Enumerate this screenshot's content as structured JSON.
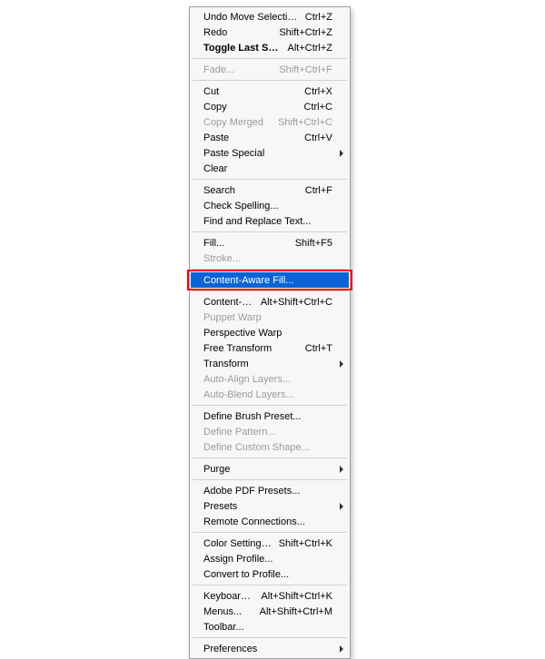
{
  "menu": {
    "name": "edit-menu",
    "items": [
      {
        "kind": "item",
        "id": "undo-move-selection",
        "label": "Undo Move Selection",
        "shortcut": "Ctrl+Z"
      },
      {
        "kind": "item",
        "id": "redo",
        "label": "Redo",
        "shortcut": "Shift+Ctrl+Z"
      },
      {
        "kind": "item",
        "id": "toggle-last-state",
        "label": "Toggle Last State",
        "shortcut": "Alt+Ctrl+Z",
        "bold": true
      },
      {
        "kind": "sep"
      },
      {
        "kind": "item",
        "id": "fade",
        "label": "Fade...",
        "shortcut": "Shift+Ctrl+F",
        "disabled": true
      },
      {
        "kind": "sep"
      },
      {
        "kind": "item",
        "id": "cut",
        "label": "Cut",
        "shortcut": "Ctrl+X"
      },
      {
        "kind": "item",
        "id": "copy",
        "label": "Copy",
        "shortcut": "Ctrl+C"
      },
      {
        "kind": "item",
        "id": "copy-merged",
        "label": "Copy Merged",
        "shortcut": "Shift+Ctrl+C",
        "disabled": true
      },
      {
        "kind": "item",
        "id": "paste",
        "label": "Paste",
        "shortcut": "Ctrl+V"
      },
      {
        "kind": "item",
        "id": "paste-special",
        "label": "Paste Special",
        "submenu": true
      },
      {
        "kind": "item",
        "id": "clear",
        "label": "Clear"
      },
      {
        "kind": "sep"
      },
      {
        "kind": "item",
        "id": "search",
        "label": "Search",
        "shortcut": "Ctrl+F"
      },
      {
        "kind": "item",
        "id": "check-spelling",
        "label": "Check Spelling..."
      },
      {
        "kind": "item",
        "id": "find-replace",
        "label": "Find and Replace Text..."
      },
      {
        "kind": "sep"
      },
      {
        "kind": "item",
        "id": "fill",
        "label": "Fill...",
        "shortcut": "Shift+F5"
      },
      {
        "kind": "item",
        "id": "stroke",
        "label": "Stroke...",
        "disabled": true
      },
      {
        "kind": "sep"
      },
      {
        "kind": "item",
        "id": "content-aware-fill",
        "label": "Content-Aware Fill...",
        "highlight": true,
        "outline": true
      },
      {
        "kind": "sep"
      },
      {
        "kind": "item",
        "id": "content-aware-scale",
        "label": "Content-Aware Scale",
        "shortcut": "Alt+Shift+Ctrl+C"
      },
      {
        "kind": "item",
        "id": "puppet-warp",
        "label": "Puppet Warp",
        "disabled": true
      },
      {
        "kind": "item",
        "id": "perspective-warp",
        "label": "Perspective Warp"
      },
      {
        "kind": "item",
        "id": "free-transform",
        "label": "Free Transform",
        "shortcut": "Ctrl+T"
      },
      {
        "kind": "item",
        "id": "transform",
        "label": "Transform",
        "submenu": true
      },
      {
        "kind": "item",
        "id": "auto-align-layers",
        "label": "Auto-Align Layers...",
        "disabled": true
      },
      {
        "kind": "item",
        "id": "auto-blend-layers",
        "label": "Auto-Blend Layers...",
        "disabled": true
      },
      {
        "kind": "sep"
      },
      {
        "kind": "item",
        "id": "define-brush-preset",
        "label": "Define Brush Preset..."
      },
      {
        "kind": "item",
        "id": "define-pattern",
        "label": "Define Pattern...",
        "disabled": true
      },
      {
        "kind": "item",
        "id": "define-custom-shape",
        "label": "Define Custom Shape...",
        "disabled": true
      },
      {
        "kind": "sep"
      },
      {
        "kind": "item",
        "id": "purge",
        "label": "Purge",
        "submenu": true
      },
      {
        "kind": "sep"
      },
      {
        "kind": "item",
        "id": "adobe-pdf-presets",
        "label": "Adobe PDF Presets..."
      },
      {
        "kind": "item",
        "id": "presets",
        "label": "Presets",
        "submenu": true
      },
      {
        "kind": "item",
        "id": "remote-connections",
        "label": "Remote Connections..."
      },
      {
        "kind": "sep"
      },
      {
        "kind": "item",
        "id": "color-settings",
        "label": "Color Settings...",
        "shortcut": "Shift+Ctrl+K"
      },
      {
        "kind": "item",
        "id": "assign-profile",
        "label": "Assign Profile..."
      },
      {
        "kind": "item",
        "id": "convert-to-profile",
        "label": "Convert to Profile..."
      },
      {
        "kind": "sep"
      },
      {
        "kind": "item",
        "id": "keyboard-shortcuts",
        "label": "Keyboard Shortcuts...",
        "shortcut": "Alt+Shift+Ctrl+K"
      },
      {
        "kind": "item",
        "id": "menus",
        "label": "Menus...",
        "shortcut": "Alt+Shift+Ctrl+M"
      },
      {
        "kind": "item",
        "id": "toolbar",
        "label": "Toolbar..."
      },
      {
        "kind": "sep"
      },
      {
        "kind": "item",
        "id": "preferences",
        "label": "Preferences",
        "submenu": true
      }
    ]
  }
}
